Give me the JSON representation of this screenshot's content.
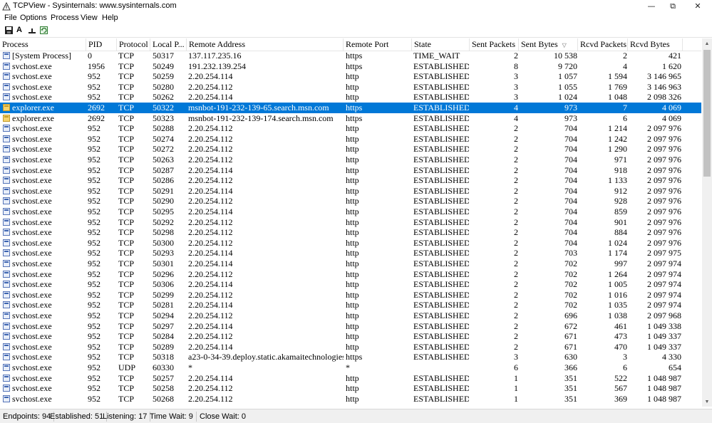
{
  "window": {
    "title": "TCPView - Sysinternals: www.sysinternals.com"
  },
  "menu": [
    "File",
    "Options",
    "Process",
    "View",
    "Help"
  ],
  "toolbar": {
    "a_label": "A"
  },
  "columns": [
    "Process",
    "PID",
    "Protocol",
    "Local P...",
    "Remote Address",
    "Remote Port",
    "State",
    "Sent Packets",
    "Sent Bytes",
    "Rcvd Packets",
    "Rcvd Bytes"
  ],
  "sort_column": "Sent Bytes",
  "rows": [
    [
      "[System Process]",
      "0",
      "TCP",
      "50317",
      "137.117.235.16",
      "https",
      "TIME_WAIT",
      "2",
      "10 538",
      "2",
      "421"
    ],
    [
      "svchost.exe",
      "1956",
      "TCP",
      "50249",
      "191.232.139.254",
      "https",
      "ESTABLISHED",
      "8",
      "9 720",
      "4",
      "1 620"
    ],
    [
      "svchost.exe",
      "952",
      "TCP",
      "50259",
      "2.20.254.114",
      "http",
      "ESTABLISHED",
      "3",
      "1 057",
      "1 594",
      "3 146 965"
    ],
    [
      "svchost.exe",
      "952",
      "TCP",
      "50280",
      "2.20.254.112",
      "http",
      "ESTABLISHED",
      "3",
      "1 055",
      "1 769",
      "3 146 963"
    ],
    [
      "svchost.exe",
      "952",
      "TCP",
      "50262",
      "2.20.254.114",
      "http",
      "ESTABLISHED",
      "3",
      "1 024",
      "1 048",
      "2 098 326"
    ],
    [
      "explorer.exe",
      "2692",
      "TCP",
      "50322",
      "msnbot-191-232-139-65.search.msn.com",
      "https",
      "ESTABLISHED",
      "4",
      "973",
      "7",
      "4 069"
    ],
    [
      "explorer.exe",
      "2692",
      "TCP",
      "50323",
      "msnbot-191-232-139-174.search.msn.com",
      "https",
      "ESTABLISHED",
      "4",
      "973",
      "6",
      "4 069"
    ],
    [
      "svchost.exe",
      "952",
      "TCP",
      "50288",
      "2.20.254.112",
      "http",
      "ESTABLISHED",
      "2",
      "704",
      "1 214",
      "2 097 976"
    ],
    [
      "svchost.exe",
      "952",
      "TCP",
      "50274",
      "2.20.254.112",
      "http",
      "ESTABLISHED",
      "2",
      "704",
      "1 242",
      "2 097 976"
    ],
    [
      "svchost.exe",
      "952",
      "TCP",
      "50272",
      "2.20.254.112",
      "http",
      "ESTABLISHED",
      "2",
      "704",
      "1 290",
      "2 097 976"
    ],
    [
      "svchost.exe",
      "952",
      "TCP",
      "50263",
      "2.20.254.112",
      "http",
      "ESTABLISHED",
      "2",
      "704",
      "971",
      "2 097 976"
    ],
    [
      "svchost.exe",
      "952",
      "TCP",
      "50287",
      "2.20.254.114",
      "http",
      "ESTABLISHED",
      "2",
      "704",
      "918",
      "2 097 976"
    ],
    [
      "svchost.exe",
      "952",
      "TCP",
      "50286",
      "2.20.254.112",
      "http",
      "ESTABLISHED",
      "2",
      "704",
      "1 133",
      "2 097 976"
    ],
    [
      "svchost.exe",
      "952",
      "TCP",
      "50291",
      "2.20.254.114",
      "http",
      "ESTABLISHED",
      "2",
      "704",
      "912",
      "2 097 976"
    ],
    [
      "svchost.exe",
      "952",
      "TCP",
      "50290",
      "2.20.254.112",
      "http",
      "ESTABLISHED",
      "2",
      "704",
      "928",
      "2 097 976"
    ],
    [
      "svchost.exe",
      "952",
      "TCP",
      "50295",
      "2.20.254.114",
      "http",
      "ESTABLISHED",
      "2",
      "704",
      "859",
      "2 097 976"
    ],
    [
      "svchost.exe",
      "952",
      "TCP",
      "50292",
      "2.20.254.112",
      "http",
      "ESTABLISHED",
      "2",
      "704",
      "901",
      "2 097 976"
    ],
    [
      "svchost.exe",
      "952",
      "TCP",
      "50298",
      "2.20.254.112",
      "http",
      "ESTABLISHED",
      "2",
      "704",
      "884",
      "2 097 976"
    ],
    [
      "svchost.exe",
      "952",
      "TCP",
      "50300",
      "2.20.254.112",
      "http",
      "ESTABLISHED",
      "2",
      "704",
      "1 024",
      "2 097 976"
    ],
    [
      "svchost.exe",
      "952",
      "TCP",
      "50293",
      "2.20.254.114",
      "http",
      "ESTABLISHED",
      "2",
      "703",
      "1 174",
      "2 097 975"
    ],
    [
      "svchost.exe",
      "952",
      "TCP",
      "50301",
      "2.20.254.114",
      "http",
      "ESTABLISHED",
      "2",
      "702",
      "997",
      "2 097 974"
    ],
    [
      "svchost.exe",
      "952",
      "TCP",
      "50296",
      "2.20.254.112",
      "http",
      "ESTABLISHED",
      "2",
      "702",
      "1 264",
      "2 097 974"
    ],
    [
      "svchost.exe",
      "952",
      "TCP",
      "50306",
      "2.20.254.114",
      "http",
      "ESTABLISHED",
      "2",
      "702",
      "1 005",
      "2 097 974"
    ],
    [
      "svchost.exe",
      "952",
      "TCP",
      "50299",
      "2.20.254.112",
      "http",
      "ESTABLISHED",
      "2",
      "702",
      "1 016",
      "2 097 974"
    ],
    [
      "svchost.exe",
      "952",
      "TCP",
      "50281",
      "2.20.254.114",
      "http",
      "ESTABLISHED",
      "2",
      "702",
      "1 035",
      "2 097 974"
    ],
    [
      "svchost.exe",
      "952",
      "TCP",
      "50294",
      "2.20.254.112",
      "http",
      "ESTABLISHED",
      "2",
      "696",
      "1 038",
      "2 097 968"
    ],
    [
      "svchost.exe",
      "952",
      "TCP",
      "50297",
      "2.20.254.114",
      "http",
      "ESTABLISHED",
      "2",
      "672",
      "461",
      "1 049 338"
    ],
    [
      "svchost.exe",
      "952",
      "TCP",
      "50284",
      "2.20.254.112",
      "http",
      "ESTABLISHED",
      "2",
      "671",
      "473",
      "1 049 337"
    ],
    [
      "svchost.exe",
      "952",
      "TCP",
      "50289",
      "2.20.254.114",
      "http",
      "ESTABLISHED",
      "2",
      "671",
      "470",
      "1 049 337"
    ],
    [
      "svchost.exe",
      "952",
      "TCP",
      "50318",
      "a23-0-34-39.deploy.static.akamaitechnologies....",
      "https",
      "ESTABLISHED",
      "3",
      "630",
      "3",
      "4 330"
    ],
    [
      "svchost.exe",
      "952",
      "UDP",
      "60330",
      "*",
      "*",
      "",
      "6",
      "366",
      "6",
      "654"
    ],
    [
      "svchost.exe",
      "952",
      "TCP",
      "50257",
      "2.20.254.114",
      "http",
      "ESTABLISHED",
      "1",
      "351",
      "522",
      "1 048 987"
    ],
    [
      "svchost.exe",
      "952",
      "TCP",
      "50258",
      "2.20.254.112",
      "http",
      "ESTABLISHED",
      "1",
      "351",
      "567",
      "1 048 987"
    ],
    [
      "svchost.exe",
      "952",
      "TCP",
      "50268",
      "2.20.254.112",
      "http",
      "ESTABLISHED",
      "1",
      "351",
      "369",
      "1 048 987"
    ]
  ],
  "selected_row": 5,
  "status": [
    "Endpoints: 94",
    "Established: 51",
    "Listening: 17",
    "Time Wait: 9",
    "Close Wait: 0"
  ],
  "colors": {
    "selection": "#0078d7"
  }
}
